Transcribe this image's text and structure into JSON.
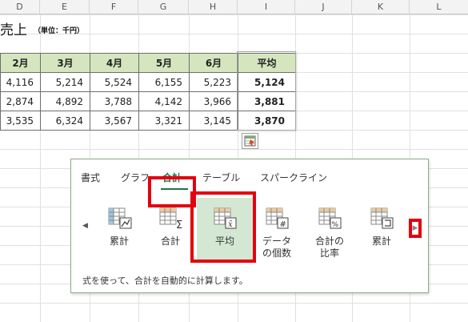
{
  "columns": [
    "D",
    "E",
    "F",
    "G",
    "H",
    "I",
    "J",
    "K",
    "L"
  ],
  "sheet_title": "売上",
  "sheet_unit": "（単位：千円）",
  "table": {
    "headers": [
      "2月",
      "3月",
      "4月",
      "5月",
      "6月",
      "平均"
    ],
    "rows": [
      [
        "4,116",
        "5,214",
        "5,524",
        "6,155",
        "5,223",
        "5,124"
      ],
      [
        "2,874",
        "4,892",
        "3,788",
        "4,142",
        "3,966",
        "3,881"
      ],
      [
        "3,535",
        "6,324",
        "3,567",
        "3,321",
        "3,145",
        "3,870"
      ]
    ]
  },
  "quick_analysis": {
    "tabs": [
      "書式",
      "グラフ",
      "合計",
      "テーブル",
      "スパークライン"
    ],
    "active_tab": "合計",
    "items": [
      {
        "label": "累計",
        "icon": "running-total-icon"
      },
      {
        "label": "合計",
        "icon": "sum-icon"
      },
      {
        "label": "平均",
        "icon": "average-icon",
        "selected": true
      },
      {
        "label": "データの個数",
        "icon": "count-icon"
      },
      {
        "label": "合計の比率",
        "icon": "percent-total-icon"
      },
      {
        "label": "累計",
        "icon": "running-total-icon"
      }
    ],
    "description": "式を使って、合計を自動的に計算します。"
  },
  "colors": {
    "header_fill": "#d5e6bf",
    "accent": "#217346",
    "highlight": "#e3000f",
    "selected_item": "#d3e7d3"
  }
}
